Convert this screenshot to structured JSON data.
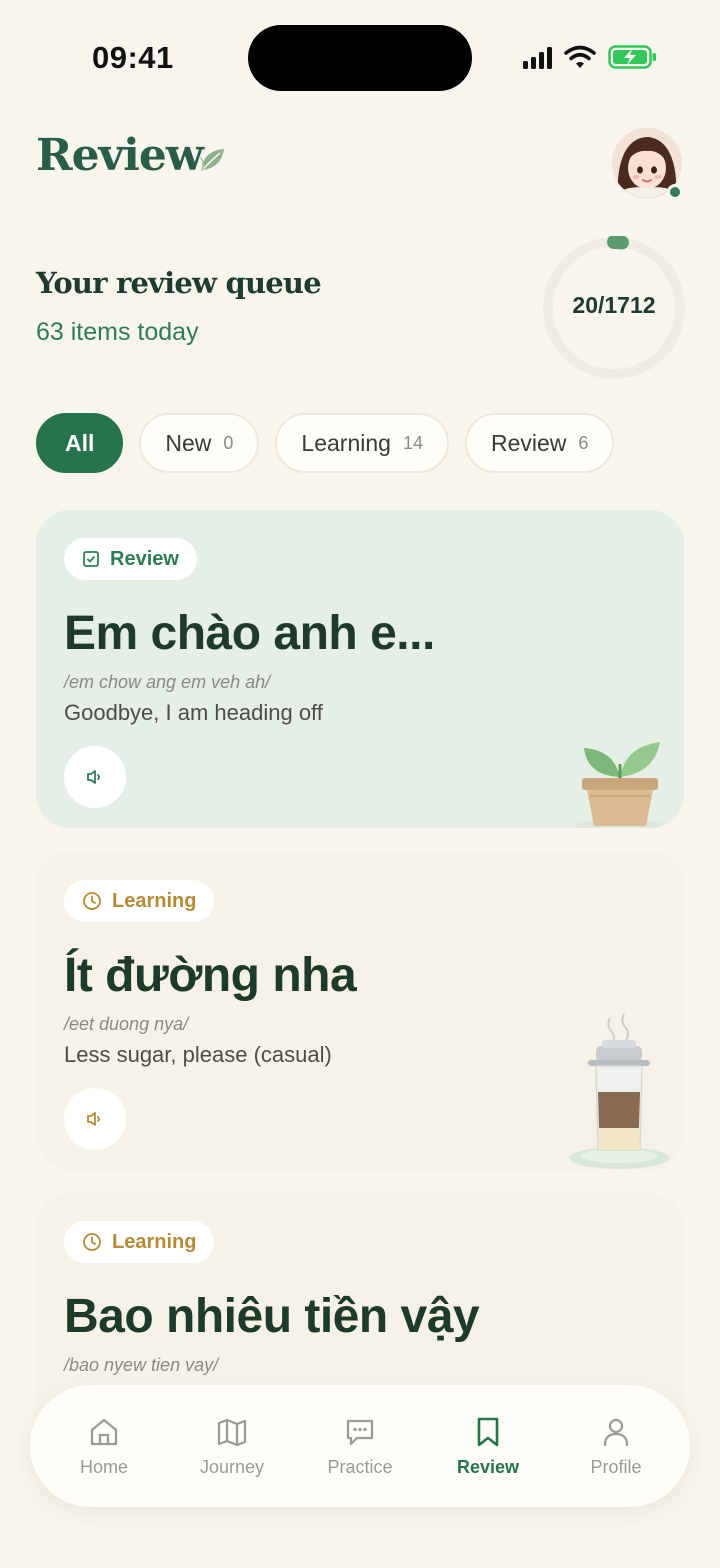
{
  "status_bar": {
    "time": "09:41"
  },
  "header": {
    "title": "Review"
  },
  "queue": {
    "title": "Your review queue",
    "subtitle": "63 items today",
    "progress_label": "20/1712",
    "progress_value": 20,
    "progress_total": 1712
  },
  "filters": [
    {
      "label": "All",
      "count": "",
      "active": true
    },
    {
      "label": "New",
      "count": "0",
      "active": false
    },
    {
      "label": "Learning",
      "count": "14",
      "active": false
    },
    {
      "label": "Review",
      "count": "6",
      "active": false
    }
  ],
  "cards": [
    {
      "status": "Review",
      "phrase": "Em chào anh e...",
      "phonetic": "/em chow ang em veh ah/",
      "translation": "Goodbye, I am heading off",
      "illustration": "potted-plant"
    },
    {
      "status": "Learning",
      "phrase": "Ít đường nha",
      "phonetic": "/eet duong nya/",
      "translation": "Less sugar, please (casual)",
      "illustration": "vietnamese-coffee-filter"
    },
    {
      "status": "Learning",
      "phrase": "Bao nhiêu tiền vậy",
      "phonetic": "/bao nyew tien vay/",
      "translation": "",
      "illustration": ""
    }
  ],
  "nav": [
    {
      "label": "Home",
      "icon": "home-icon",
      "active": false
    },
    {
      "label": "Journey",
      "icon": "map-icon",
      "active": false
    },
    {
      "label": "Practice",
      "icon": "chat-icon",
      "active": false
    },
    {
      "label": "Review",
      "icon": "bookmark-icon",
      "active": true
    },
    {
      "label": "Profile",
      "icon": "user-icon",
      "active": false
    }
  ],
  "colors": {
    "accent": "#26734c",
    "background": "#f8f5ee",
    "review_card": "#e6efe5",
    "learning_badge": "#b58b3a"
  }
}
